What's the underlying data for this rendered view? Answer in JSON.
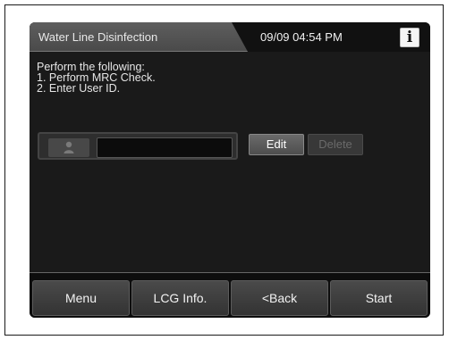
{
  "header": {
    "title": "Water Line Disinfection",
    "datetime": "09/09 04:54 PM",
    "info_label": "i"
  },
  "instructions": {
    "heading": "Perform the following:",
    "steps": [
      "1. Perform MRC Check.",
      "2. Enter User ID."
    ]
  },
  "user": {
    "icon": "user-icon",
    "value": "",
    "edit_label": "Edit",
    "delete_label": "Delete"
  },
  "footer": {
    "buttons": [
      {
        "label": "Menu"
      },
      {
        "label": "LCG Info."
      },
      {
        "label": "<Back"
      },
      {
        "label": "Start"
      }
    ]
  }
}
